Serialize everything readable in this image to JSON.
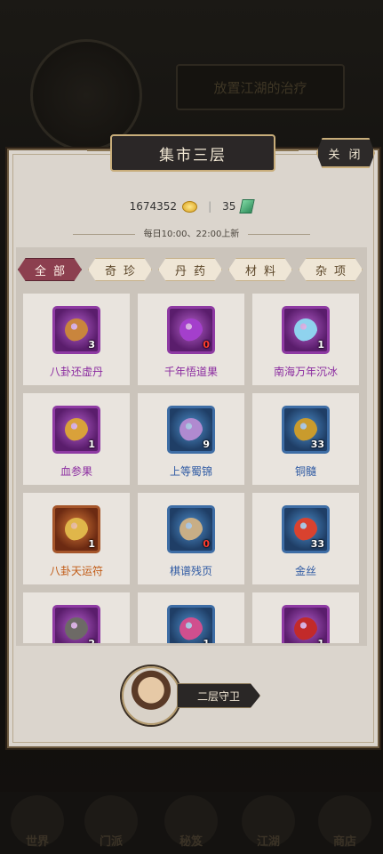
{
  "background": {
    "banner_text": "放置江湖的治疗",
    "bottom_nav": [
      "世界",
      "门派",
      "秘笈",
      "江湖",
      "商店"
    ]
  },
  "modal": {
    "title": "集市三层",
    "close_label": "关 闭",
    "currency": {
      "coins": "1674352",
      "jade": "35"
    },
    "refresh_note": "每日10:00、22:00上新",
    "tabs": [
      {
        "label": "全部",
        "active": true
      },
      {
        "label": "奇珍",
        "active": false
      },
      {
        "label": "丹药",
        "active": false
      },
      {
        "label": "材料",
        "active": false
      },
      {
        "label": "杂项",
        "active": false
      }
    ],
    "items": [
      {
        "name": "八卦还虚丹",
        "count": "3",
        "quality": "purple",
        "icon": "elixir-box-icon",
        "color": "#c9853d"
      },
      {
        "name": "千年悟道果",
        "count": "0",
        "quality": "purple",
        "icon": "fruit-bowl-icon",
        "color": "#a43fcc"
      },
      {
        "name": "南海万年沉冰",
        "count": "1",
        "quality": "purple",
        "icon": "ice-crystal-icon",
        "color": "#8fd3ee"
      },
      {
        "name": "血参果",
        "count": "1",
        "quality": "purple",
        "icon": "gourd-icon",
        "color": "#d9a13a"
      },
      {
        "name": "上等蜀锦",
        "count": "9",
        "quality": "blue",
        "icon": "silk-roll-icon",
        "color": "#b08ad0"
      },
      {
        "name": "铜髓",
        "count": "33",
        "quality": "blue",
        "icon": "copper-ore-icon",
        "color": "#c99b2d"
      },
      {
        "name": "八卦天运符",
        "count": "1",
        "quality": "orange",
        "icon": "talisman-icon",
        "color": "#e0b64a"
      },
      {
        "name": "棋谱残页",
        "count": "0",
        "quality": "blue",
        "icon": "scroll-page-icon",
        "color": "#c8ae86"
      },
      {
        "name": "金丝",
        "count": "33",
        "quality": "blue",
        "icon": "gold-thread-icon",
        "color": "#d9422f"
      },
      {
        "name": "",
        "count": "2",
        "quality": "purple",
        "icon": "stone-icon",
        "color": "#6d6a66"
      },
      {
        "name": "",
        "count": "1",
        "quality": "blue",
        "icon": "pearl-icon",
        "color": "#d04f8e"
      },
      {
        "name": "",
        "count": "1",
        "quality": "purple",
        "icon": "red-pouch-icon",
        "color": "#c22a2a"
      }
    ],
    "guard_label": "二层守卫"
  }
}
